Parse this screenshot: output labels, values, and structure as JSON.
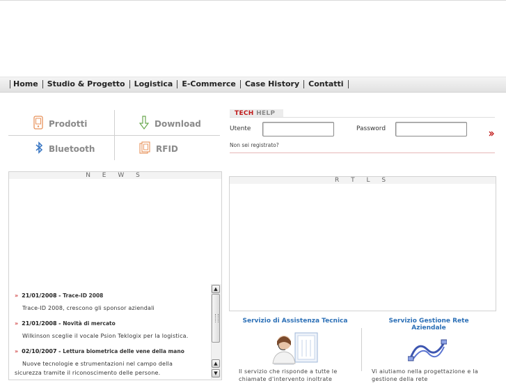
{
  "nav": {
    "items": [
      "Home",
      "Studio & Progetto",
      "Logistica",
      "E-Commerce",
      "Case History",
      "Contatti"
    ]
  },
  "quicklinks": {
    "prodotti": "Prodotti",
    "download": "Download",
    "bluetooth": "Bluetooth",
    "rfid": "RFID"
  },
  "techhelp": {
    "title_a": "TECH",
    "title_b": "HELP",
    "user_label": "Utente",
    "user_value": "",
    "password_label": "Password",
    "password_value": "",
    "register_link": "Non sei registrato?"
  },
  "news": {
    "header": "N E W S",
    "items": [
      {
        "date": "21/01/2008",
        "title": "Trace-ID 2008",
        "body": "Trace-ID 2008, crescono gli sponsor aziendali"
      },
      {
        "date": "21/01/2008",
        "title": "Novità di mercato",
        "body": "Wilkinson sceglie il vocale Psion Teklogix per la logistica."
      },
      {
        "date": "02/10/2007",
        "title": "Lettura biometrica delle vene della mano",
        "body1": "Nuove tecnologie e strumentazioni nel campo della",
        "body2": "sicurezza tramite il riconoscimento delle persone."
      }
    ]
  },
  "rtls": {
    "header": "R T L S"
  },
  "services": {
    "assistenza": {
      "title": "Servizio di Assistenza Tecnica",
      "desc1": "Il servizio che risponde a tutte le",
      "desc2": "chiamate d'intervento inoltrate"
    },
    "rete": {
      "title1": "Servizio Gestione Rete",
      "title2": "Aziendale",
      "desc1": "Vi aiutiamo nella progettazione e la",
      "desc2": "gestione della rete"
    }
  },
  "colors": {
    "accent_red": "#c01818",
    "link_blue": "#2b6fb6",
    "icon_orange": "#e8925a",
    "icon_green": "#6aa84f"
  }
}
